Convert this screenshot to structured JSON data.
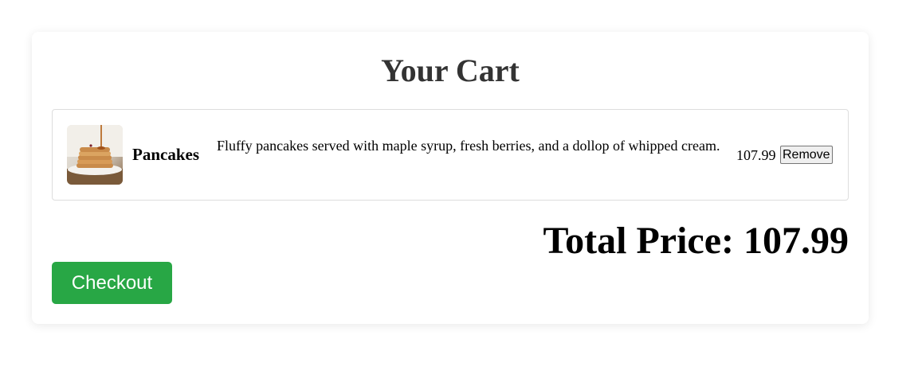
{
  "cart": {
    "title": "Your Cart",
    "items": [
      {
        "name": "Pancakes",
        "description": "Fluffy pancakes served with maple syrup, fresh berries, and a dollop of whipped cream.",
        "price": "107.99",
        "remove_label": "Remove",
        "image": "pancakes-photo"
      }
    ],
    "total_label": "Total Price: 107.99",
    "checkout_label": "Checkout"
  },
  "colors": {
    "checkout_button": "#28a745",
    "title_text": "#333333",
    "item_border": "#dddddd"
  }
}
